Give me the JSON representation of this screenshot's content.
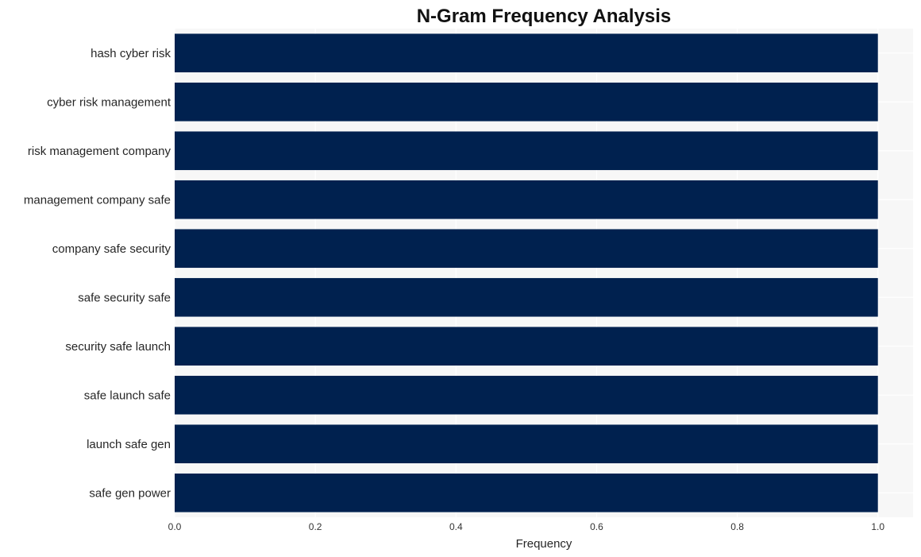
{
  "chart_data": {
    "type": "bar",
    "orientation": "horizontal",
    "title": "N-Gram Frequency Analysis",
    "xlabel": "Frequency",
    "ylabel": "",
    "categories": [
      "hash cyber risk",
      "cyber risk management",
      "risk management company",
      "management company safe",
      "company safe security",
      "safe security safe",
      "security safe launch",
      "safe launch safe",
      "launch safe gen",
      "safe gen power"
    ],
    "values": [
      1,
      1,
      1,
      1,
      1,
      1,
      1,
      1,
      1,
      1
    ],
    "xlim": [
      0,
      1.05
    ],
    "xticks": [
      0.0,
      0.2,
      0.4,
      0.6,
      0.8,
      1.0
    ],
    "xtick_labels": [
      "0.0",
      "0.2",
      "0.4",
      "0.6",
      "0.8",
      "1.0"
    ],
    "grid": true,
    "legend": "none",
    "colors": {
      "bar": "#00214f",
      "plot_background": "#f7f7f7",
      "grid": "#ffffff"
    }
  }
}
